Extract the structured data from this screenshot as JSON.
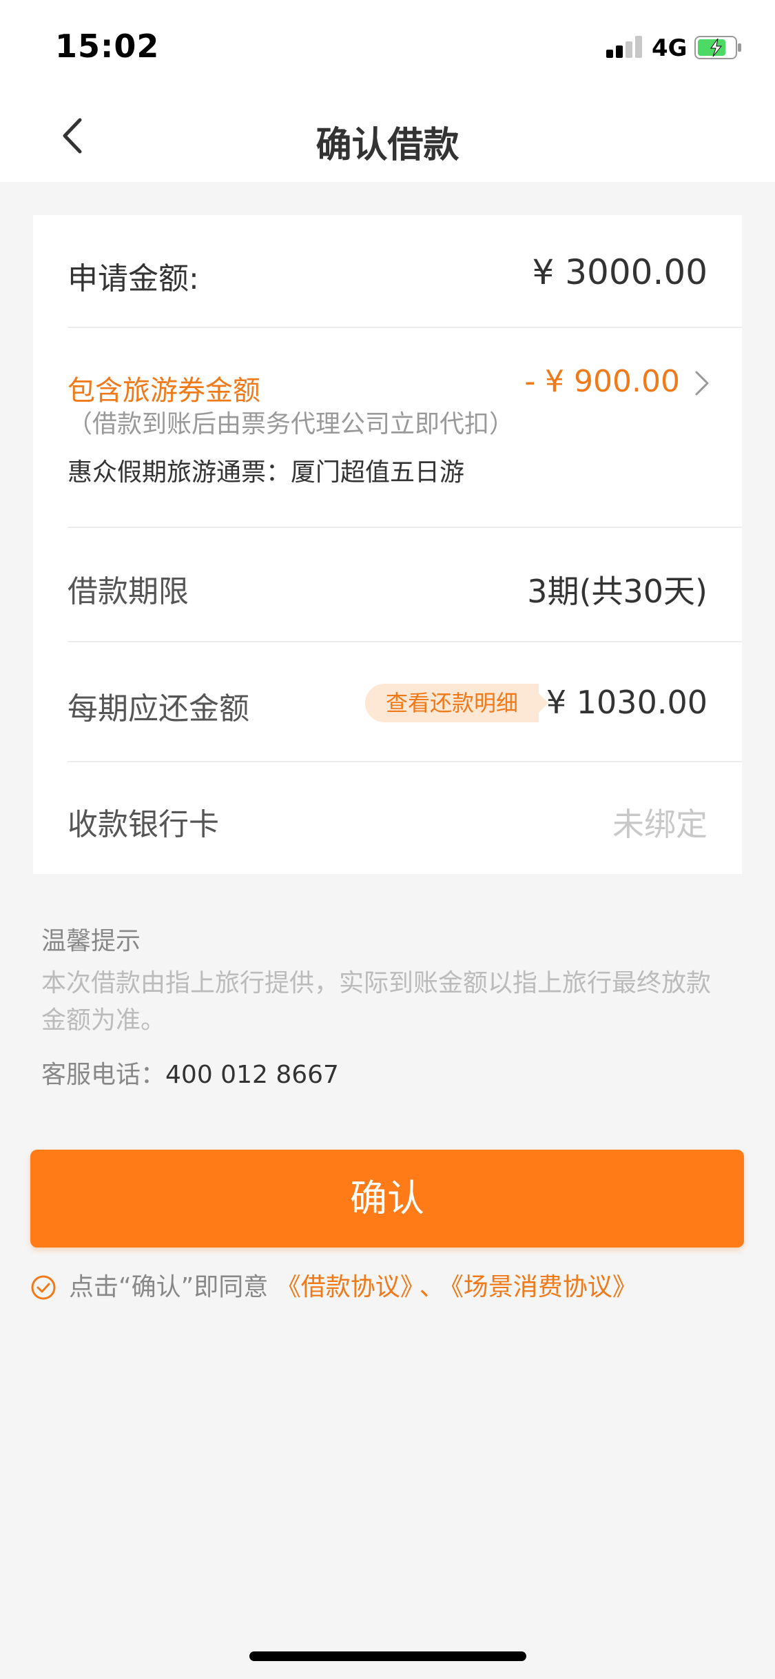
{
  "status_bar": {
    "time": "15:02",
    "network": "4G",
    "signal_bars_active": 2,
    "signal_bars_total": 4,
    "battery_state": "charging"
  },
  "nav": {
    "title": "确认借款",
    "back_icon": "chevron-left-icon"
  },
  "loan": {
    "apply_amount_label": "申请金额:",
    "apply_amount_value": "¥ 3000.00",
    "voucher_label": "包含旅游券金额",
    "voucher_note": "（借款到账后由票务代理公司立即代扣）",
    "voucher_value": "- ¥ 900.00",
    "voucher_desc": "惠众假期旅游通票：厦门超值五日游",
    "term_label": "借款期限",
    "term_value": "3期(共30天)",
    "installment_label": "每期应还金额",
    "installment_detail_tag": "查看还款明细",
    "installment_value": "¥ 1030.00",
    "bank_card_label": "收款银行卡",
    "bank_card_value": "未绑定"
  },
  "tips": {
    "title": "温馨提示",
    "text": "本次借款由指上旅行提供，实际到账金额以指上旅行最终放款金额为准。",
    "hotline_label": "客服电话：",
    "hotline_number": "400 012 8667"
  },
  "confirm_button": "确认",
  "agreement": {
    "prefix": "点击“确认”即同意",
    "link1": "《借款协议》",
    "separator": "、",
    "link2": "《场景消费协议》",
    "checked": true
  },
  "colors": {
    "accent": "#ff7b17",
    "accent_text": "#f07a1a",
    "background": "#f5f5f5"
  }
}
